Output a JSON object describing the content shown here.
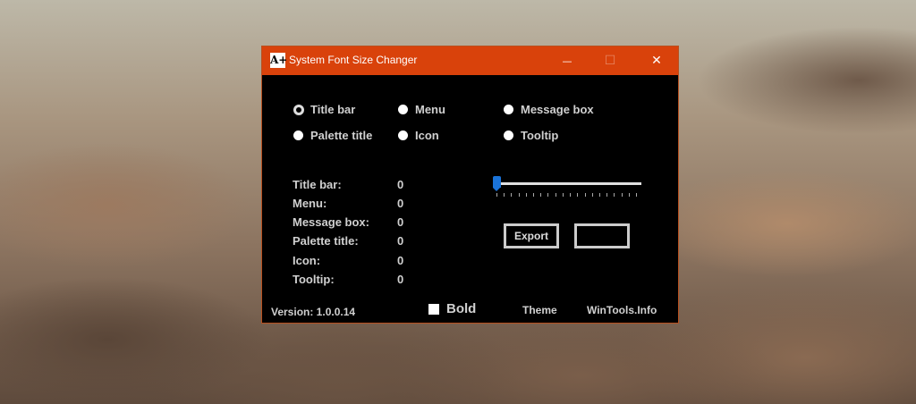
{
  "window": {
    "title": "System Font Size Changer",
    "app_icon_text": "A+",
    "minimize_glyph": "—",
    "maximize_glyph": "☐",
    "close_glyph": "✕"
  },
  "radios": [
    {
      "label": "Title bar",
      "selected": true
    },
    {
      "label": "Menu",
      "selected": false
    },
    {
      "label": "Message box",
      "selected": false
    },
    {
      "label": "Palette title",
      "selected": false
    },
    {
      "label": "Icon",
      "selected": false
    },
    {
      "label": "Tooltip",
      "selected": false
    }
  ],
  "values": [
    {
      "label": "Title bar:",
      "value": "0"
    },
    {
      "label": "Menu:",
      "value": "0"
    },
    {
      "label": "Message box:",
      "value": "0"
    },
    {
      "label": "Palette title:",
      "value": "0"
    },
    {
      "label": "Icon:",
      "value": "0"
    },
    {
      "label": "Tooltip:",
      "value": "0"
    }
  ],
  "slider": {
    "value": 0,
    "ticks": 20
  },
  "buttons": {
    "export": "Export",
    "blank": ""
  },
  "footer": {
    "version": "Version: 1.0.0.14",
    "bold": "Bold",
    "bold_checked": false,
    "theme": "Theme",
    "site": "WinTools.Info"
  },
  "colors": {
    "titlebar": "#d9420b",
    "slider_thumb": "#1a73d9"
  }
}
